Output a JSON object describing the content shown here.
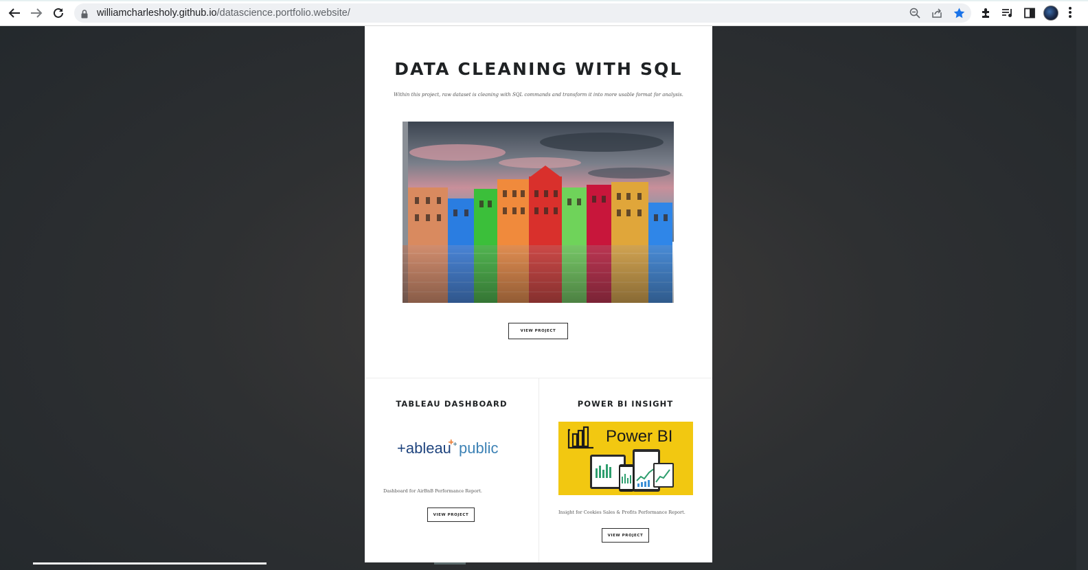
{
  "browser": {
    "url_host": "williamcharlesholy.github.io",
    "url_path": "/datascience.portfolio.website/",
    "icons": [
      "back-arrow-icon",
      "forward-arrow-icon",
      "reload-icon",
      "lock-icon",
      "zoom-icon",
      "share-icon",
      "bookmark-star-icon",
      "extensions-icon",
      "media-controls-icon",
      "side-panel-icon",
      "profile-avatar",
      "more-menu-icon"
    ],
    "accent": "#1a73e8"
  },
  "hero": {
    "title": "DATA CLEANING WITH SQL",
    "description": "Within this project, raw dataset is cleaning with SQL commands and transform it into more usable format for analysis.",
    "button_label": "VIEW PROJECT"
  },
  "cards": [
    {
      "title": "TABLEAU DASHBOARD",
      "logo_text_left": "+ableau",
      "logo_text_right": "public",
      "description": "Dashboard for AirBnB Performance Report.",
      "button_label": "VIEW PROJECT"
    },
    {
      "title": "POWER BI INSIGHT",
      "logo_text": "Power BI",
      "description": "Insight for Cookies Sales & Profits Performance Report.",
      "button_label": "VIEW PROJECT"
    }
  ]
}
